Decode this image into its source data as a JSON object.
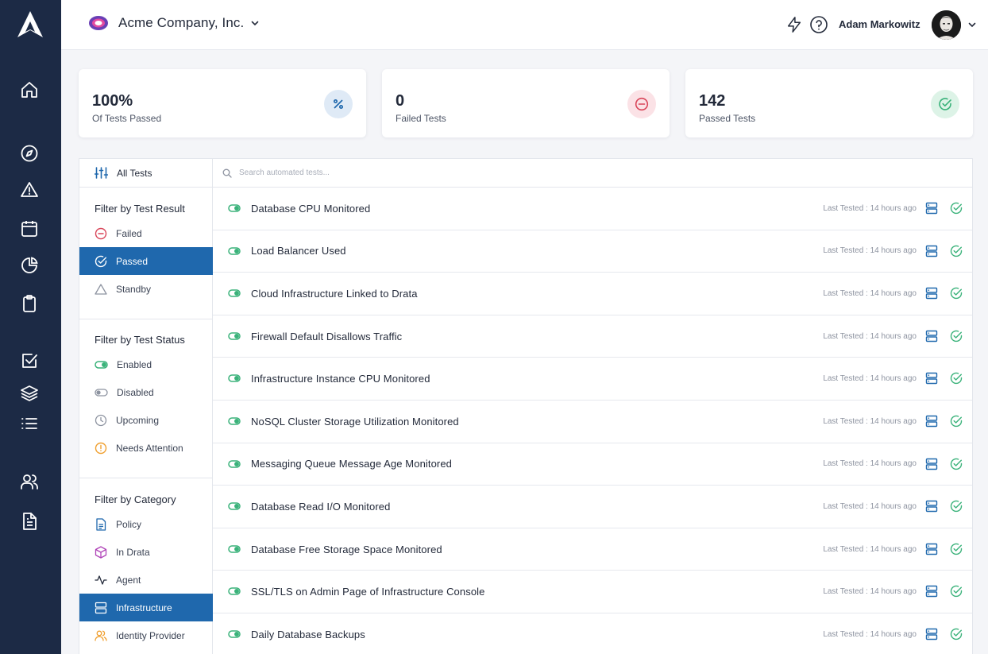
{
  "rail": {
    "logo": "acme-a-logo",
    "items": [
      {
        "icon": "home-icon"
      },
      {
        "icon": "compass-icon"
      },
      {
        "icon": "warning-icon"
      },
      {
        "icon": "calendar-icon"
      },
      {
        "icon": "pie-chart-icon"
      },
      {
        "icon": "clipboard-icon"
      },
      {
        "icon": "checkbox-icon"
      },
      {
        "icon": "layers-icon"
      },
      {
        "icon": "list-icon"
      },
      {
        "icon": "users-icon"
      },
      {
        "icon": "document-icon"
      }
    ]
  },
  "header": {
    "org_name": "Acme Company, Inc.",
    "user_name": "Adam Markowitz"
  },
  "stats": [
    {
      "value": "100%",
      "label": "Of Tests Passed",
      "icon": "percent-icon",
      "color": "#1f68ad",
      "bg": "#dfeaf6"
    },
    {
      "value": "0",
      "label": "Failed Tests",
      "icon": "minus-circle-icon",
      "color": "#d9465a",
      "bg": "#fbe2e6"
    },
    {
      "value": "142",
      "label": "Passed Tests",
      "icon": "check-circle-icon",
      "color": "#3ab27a",
      "bg": "#ddf3e7"
    }
  ],
  "filters": {
    "all_tests": "All Tests",
    "result_title": "Filter by Test Result",
    "result_items": [
      "Failed",
      "Passed",
      "Standby"
    ],
    "status_title": "Filter by Test Status",
    "status_items": [
      "Enabled",
      "Disabled",
      "Upcoming",
      "Needs Attention"
    ],
    "category_title": "Filter by Category",
    "category_items": [
      "Policy",
      "In Drata",
      "Agent",
      "Infrastructure",
      "Identity Provider"
    ]
  },
  "search": {
    "placeholder": "Search automated tests..."
  },
  "tests": [
    {
      "name": "Database CPU Monitored",
      "last_tested": "Last Tested : 14 hours ago"
    },
    {
      "name": "Load Balancer Used",
      "last_tested": "Last Tested : 14 hours ago"
    },
    {
      "name": "Cloud Infrastructure Linked to Drata",
      "last_tested": "Last Tested : 14 hours ago"
    },
    {
      "name": "Firewall Default Disallows Traffic",
      "last_tested": "Last Tested : 14 hours ago"
    },
    {
      "name": "Infrastructure Instance CPU Monitored",
      "last_tested": "Last Tested : 14 hours ago"
    },
    {
      "name": "NoSQL Cluster Storage Utilization Monitored",
      "last_tested": "Last Tested : 14 hours ago"
    },
    {
      "name": "Messaging Queue Message Age Monitored",
      "last_tested": "Last Tested : 14 hours ago"
    },
    {
      "name": "Database Read I/O Monitored",
      "last_tested": "Last Tested : 14 hours ago"
    },
    {
      "name": "Database Free Storage Space Monitored",
      "last_tested": "Last Tested : 14 hours ago"
    },
    {
      "name": "SSL/TLS on Admin Page of Infrastructure Console",
      "last_tested": "Last Tested : 14 hours ago"
    },
    {
      "name": "Daily Database Backups",
      "last_tested": "Last Tested : 14 hours ago"
    }
  ],
  "colors": {
    "rail": "#1c2a45",
    "accent": "#1f68ad",
    "success": "#3ab27a",
    "danger": "#d9465a",
    "warning": "#f0a030"
  }
}
